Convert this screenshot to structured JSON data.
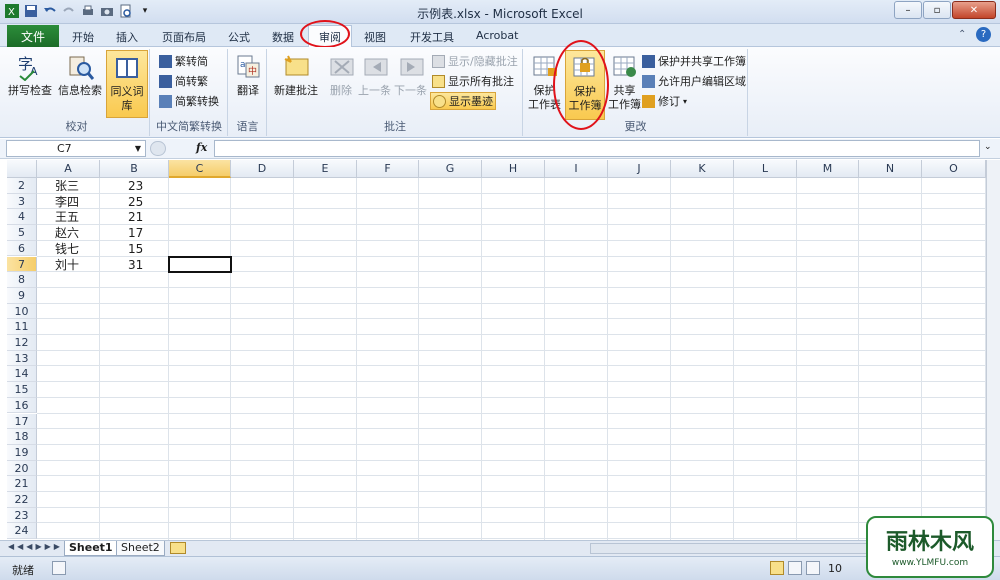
{
  "window": {
    "title": "示例表.xlsx - Microsoft Excel",
    "controls": [
      "–",
      "▫",
      "✕"
    ]
  },
  "tabs": [
    {
      "label": "文件"
    },
    {
      "label": "开始"
    },
    {
      "label": "插入"
    },
    {
      "label": "页面布局"
    },
    {
      "label": "公式"
    },
    {
      "label": "数据"
    },
    {
      "label": "审阅"
    },
    {
      "label": "视图"
    },
    {
      "label": "开发工具"
    },
    {
      "label": "Acrobat"
    }
  ],
  "ribbon": {
    "proof": {
      "spell": "拼写检查",
      "research": "信息检索",
      "thesaurus": "同义词库",
      "group": "校对"
    },
    "chinese": {
      "t2s": "繁转简",
      "s2t": "简转繁",
      "conv": "简繁转换",
      "group": "中文简繁转换"
    },
    "lang": {
      "translate": "翻译",
      "group": "语言"
    },
    "comments": {
      "new": "新建批注",
      "delete": "删除",
      "prev": "上一条",
      "next": "下一条",
      "showhide": "显示/隐藏批注",
      "showall": "显示所有批注",
      "ink": "显示墨迹",
      "group": "批注"
    },
    "changes": {
      "protect_sheet_1": "保护",
      "protect_sheet_2": "工作表",
      "protect_book_1": "保护",
      "protect_book_2": "工作簿",
      "share_1": "共享",
      "share_2": "工作簿",
      "protect_share": "保护并共享工作簿",
      "allow_edit": "允许用户编辑区域",
      "track": "修订",
      "group": "更改"
    }
  },
  "formula_bar": {
    "name_box": "C7",
    "fx": "fx"
  },
  "columns": [
    "A",
    "B",
    "C",
    "D",
    "E",
    "F",
    "G",
    "H",
    "I",
    "J",
    "K",
    "L",
    "M",
    "N",
    "O"
  ],
  "rows": [
    "2",
    "3",
    "4",
    "5",
    "6",
    "7",
    "8",
    "9",
    "10",
    "11",
    "12",
    "13",
    "14",
    "15",
    "16",
    "17",
    "18",
    "19",
    "20",
    "21",
    "22",
    "23",
    "24"
  ],
  "data": [
    [
      "张三",
      "23"
    ],
    [
      "李四",
      "25"
    ],
    [
      "王五",
      "21"
    ],
    [
      "赵六",
      "17"
    ],
    [
      "钱七",
      "15"
    ],
    [
      "刘十",
      "31"
    ]
  ],
  "sheets": [
    "Sheet1",
    "Sheet2"
  ],
  "status": {
    "ready": "就绪",
    "zoom": "10"
  },
  "watermark": {
    "line1": "雨林木风",
    "line2": "www.YLMFU.com"
  }
}
